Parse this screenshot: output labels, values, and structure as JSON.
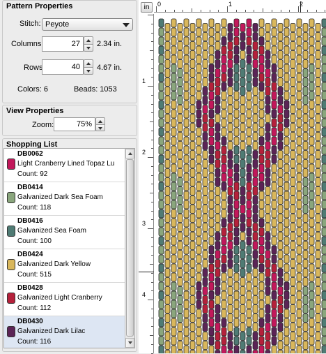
{
  "pattern": {
    "title": "Pattern Properties",
    "stitch_label": "Stitch:",
    "stitch_value": "Peyote",
    "columns_label": "Columns:",
    "columns_value": "27",
    "columns_in": "2.34 in.",
    "rows_label": "Rows:",
    "rows_value": "40",
    "rows_in": "4.67 in.",
    "colors_text": "Colors: 6",
    "beads_text": "Beads: 1053"
  },
  "view": {
    "title": "View Properties",
    "zoom_label": "Zoom:",
    "zoom_value": "75%"
  },
  "shopping": {
    "title": "Shopping List",
    "items": [
      {
        "code": "DB0062",
        "name": "Light Cranberry Lined Topaz Lu",
        "count": "Count: 92",
        "color": "#c2185b"
      },
      {
        "code": "DB0414",
        "name": "Galvanized Dark Sea Foam",
        "count": "Count: 118",
        "color": "#8aa67d"
      },
      {
        "code": "DB0416",
        "name": "Galvanized Sea Foam",
        "count": "Count: 100",
        "color": "#4f7b74"
      },
      {
        "code": "DB0424",
        "name": "Galvanized Dark Yellow",
        "count": "Count: 515",
        "color": "#d9b75c"
      },
      {
        "code": "DB0428",
        "name": "Galvanized Light Cranberry",
        "count": "Count: 112",
        "color": "#b5213b"
      },
      {
        "code": "DB0430",
        "name": "Galvanized Dark Lilac",
        "count": "Count: 116",
        "color": "#5b2456"
      }
    ]
  },
  "canvas": {
    "unit_button": "in",
    "ruler_top_labels": [
      "0",
      "1",
      "2"
    ],
    "ruler_left_labels": [
      "1",
      "2",
      "3",
      "4"
    ]
  }
}
